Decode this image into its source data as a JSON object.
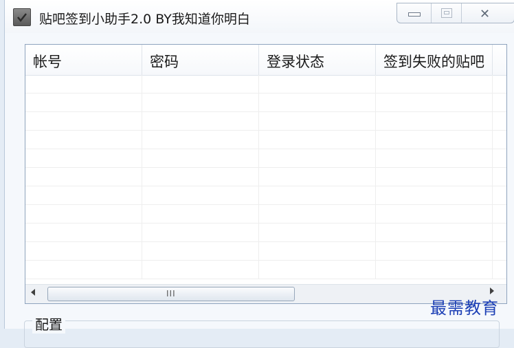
{
  "window": {
    "title": "贴吧签到小助手2.0  BY我知道你明白",
    "app_icon": "checkbox-icon",
    "caption_buttons": [
      "minimize-icon",
      "maximize-icon",
      "close-icon"
    ],
    "close_glyph": "✕"
  },
  "listview": {
    "columns": [
      "帐号",
      "密码",
      "登录状态",
      "签到失败的贴吧"
    ],
    "rows": [],
    "scroll_grip": "III"
  },
  "config": {
    "group_label": "配置"
  },
  "watermark": "最需教育"
}
